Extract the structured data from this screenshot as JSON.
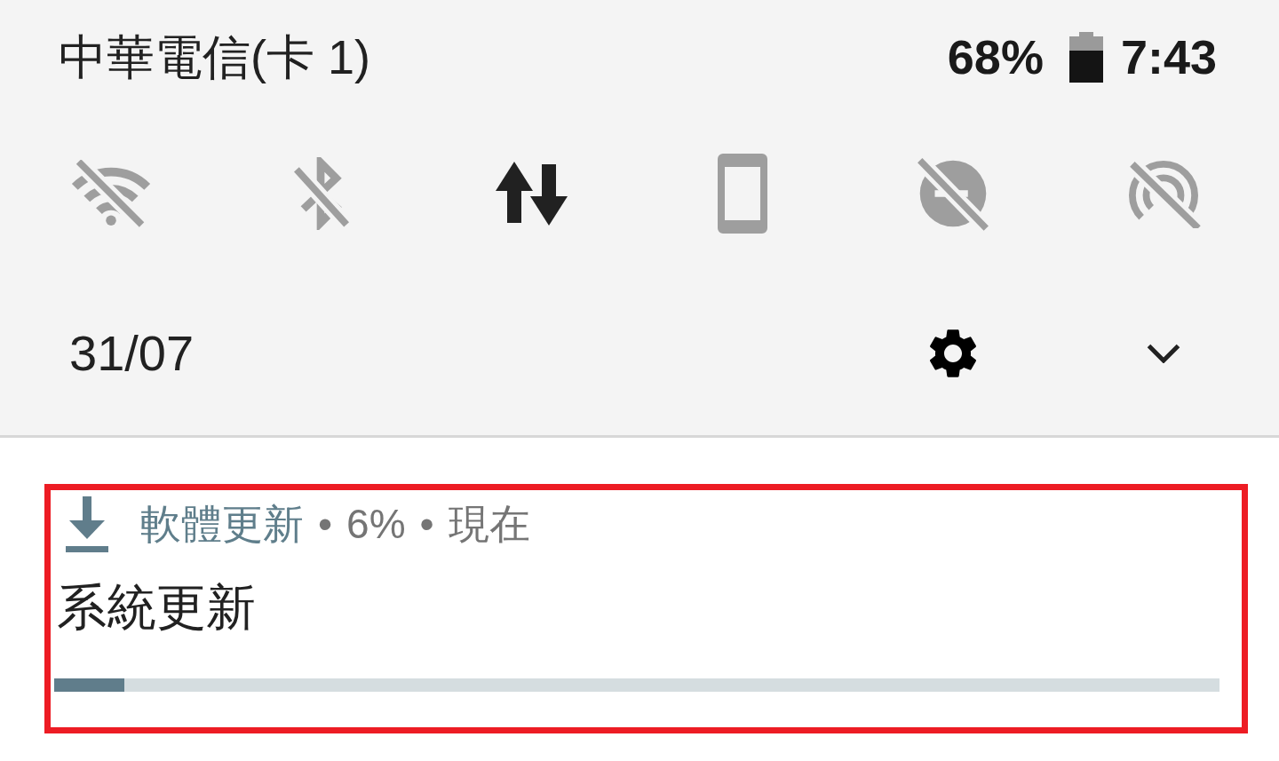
{
  "status_bar": {
    "carrier": "中華電信(卡 1)",
    "battery": "68%",
    "time": "7:43"
  },
  "quick_settings": [
    {
      "kind": "wifi",
      "on": false
    },
    {
      "kind": "bluetooth",
      "on": false
    },
    {
      "kind": "mobile_data",
      "on": true
    },
    {
      "kind": "rotation",
      "on": false
    },
    {
      "kind": "do_not_disturb",
      "on": false
    },
    {
      "kind": "hotspot",
      "on": false
    }
  ],
  "footer": {
    "date": "31/07"
  },
  "notification": {
    "header": [
      {
        "kind": "app",
        "text": "軟體更新"
      },
      {
        "kind": "separator",
        "text": "•"
      },
      {
        "kind": "info",
        "text": "6%"
      },
      {
        "kind": "separator",
        "text": "•"
      },
      {
        "kind": "time",
        "text": "現在"
      }
    ],
    "title": "系統更新",
    "progress": {
      "level": 0.06
    }
  }
}
